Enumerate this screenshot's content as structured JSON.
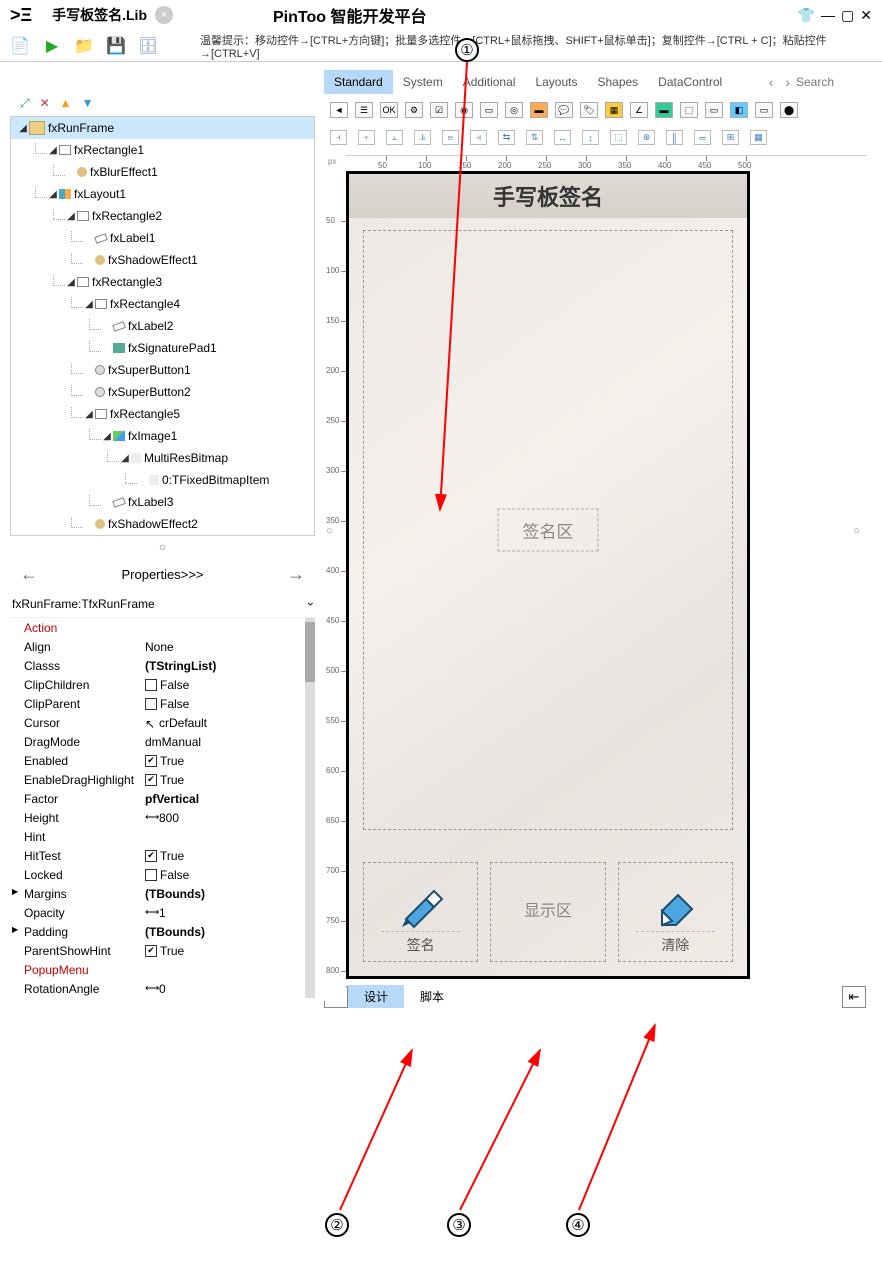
{
  "titlebar": {
    "logo": ">Ξ",
    "filename": "手写板签名.Lib",
    "apptitle": "PinToo 智能开发平台",
    "shirt_icon": "👕"
  },
  "hint": "温馨提示：移动控件→[CTRL+方向键]；批量多选控件→[CTRL+鼠标拖拽、SHIFT+鼠标单击]；复制控件→[CTRL + C]；粘贴控件→[CTRL+V]",
  "tree": {
    "items": [
      {
        "name": "fxRunFrame",
        "depth": 0,
        "icon": "icon-frame",
        "selected": true,
        "collapsible": true
      },
      {
        "name": "fxRectangle1",
        "depth": 1,
        "icon": "icon-rect",
        "collapsible": true
      },
      {
        "name": "fxBlurEffect1",
        "depth": 2,
        "icon": "icon-effect"
      },
      {
        "name": "fxLayout1",
        "depth": 1,
        "icon": "icon-layout",
        "collapsible": true
      },
      {
        "name": "fxRectangle2",
        "depth": 2,
        "icon": "icon-rect",
        "collapsible": true
      },
      {
        "name": "fxLabel1",
        "depth": 3,
        "icon": "icon-label"
      },
      {
        "name": "fxShadowEffect1",
        "depth": 3,
        "icon": "icon-effect"
      },
      {
        "name": "fxRectangle3",
        "depth": 2,
        "icon": "icon-rect",
        "collapsible": true
      },
      {
        "name": "fxRectangle4",
        "depth": 3,
        "icon": "icon-rect",
        "collapsible": true
      },
      {
        "name": "fxLabel2",
        "depth": 4,
        "icon": "icon-label"
      },
      {
        "name": "fxSignaturePad1",
        "depth": 4,
        "icon": "icon-sig"
      },
      {
        "name": "fxSuperButton1",
        "depth": 3,
        "icon": "icon-btn"
      },
      {
        "name": "fxSuperButton2",
        "depth": 3,
        "icon": "icon-btn"
      },
      {
        "name": "fxRectangle5",
        "depth": 3,
        "icon": "icon-rect",
        "collapsible": true
      },
      {
        "name": "fxImage1",
        "depth": 4,
        "icon": "icon-img",
        "collapsible": true
      },
      {
        "name": "MultiResBitmap",
        "depth": 5,
        "icon": "icon-bmp",
        "collapsible": true
      },
      {
        "name": "0:TFixedBitmapItem",
        "depth": 6,
        "icon": "icon-bmp"
      },
      {
        "name": "fxLabel3",
        "depth": 4,
        "icon": "icon-label"
      },
      {
        "name": "fxShadowEffect2",
        "depth": 3,
        "icon": "icon-effect"
      }
    ]
  },
  "props_header": "Properties>>>",
  "selector": "fxRunFrame:TfxRunFrame",
  "properties": [
    {
      "name": "Action",
      "value": "",
      "red": true
    },
    {
      "name": "Align",
      "value": "None"
    },
    {
      "name": "Classs",
      "value": "(TStringList)",
      "bold": true
    },
    {
      "name": "ClipChildren",
      "value": "False",
      "checkbox": true,
      "checked": false
    },
    {
      "name": "ClipParent",
      "value": "False",
      "checkbox": true,
      "checked": false
    },
    {
      "name": "Cursor",
      "value": "crDefault",
      "cursoricon": true
    },
    {
      "name": "DragMode",
      "value": "dmManual"
    },
    {
      "name": "Enabled",
      "value": "True",
      "checkbox": true,
      "checked": true
    },
    {
      "name": "EnableDragHighlight",
      "value": "True",
      "checkbox": true,
      "checked": true
    },
    {
      "name": "Factor",
      "value": "pfVertical",
      "bold": true
    },
    {
      "name": "Height",
      "value": "800",
      "slidericon": true
    },
    {
      "name": "Hint",
      "value": ""
    },
    {
      "name": "HitTest",
      "value": "True",
      "checkbox": true,
      "checked": true
    },
    {
      "name": "Locked",
      "value": "False",
      "checkbox": true,
      "checked": false
    },
    {
      "name": "Margins",
      "value": "(TBounds)",
      "bold": true,
      "expandable": true
    },
    {
      "name": "Opacity",
      "value": "1",
      "slidericon": true
    },
    {
      "name": "Padding",
      "value": "(TBounds)",
      "bold": true,
      "expandable": true
    },
    {
      "name": "ParentShowHint",
      "value": "True",
      "checkbox": true,
      "checked": true
    },
    {
      "name": "PopupMenu",
      "value": "",
      "red": true
    },
    {
      "name": "RotationAngle",
      "value": "0",
      "slidericon": true
    }
  ],
  "comptabs": [
    "Standard",
    "System",
    "Additional",
    "Layouts",
    "Shapes",
    "DataControl"
  ],
  "search_placeholder": "Search",
  "ruler_ticks": [
    "50",
    "100",
    "150",
    "200",
    "250",
    "300",
    "350",
    "400",
    "450",
    "500"
  ],
  "ruler_vticks": [
    "50",
    "100",
    "150",
    "200",
    "250",
    "300",
    "350",
    "400",
    "450",
    "500",
    "550",
    "600",
    "650",
    "700",
    "750",
    "800"
  ],
  "app": {
    "header": "手写板签名",
    "sig_label": "签名区",
    "btn_sign": "签名",
    "btn_display": "显示区",
    "btn_clear": "清除"
  },
  "bottom_tabs": {
    "design": "设计",
    "script": "脚本"
  },
  "annotations": [
    "①",
    "②",
    "③",
    "④"
  ]
}
